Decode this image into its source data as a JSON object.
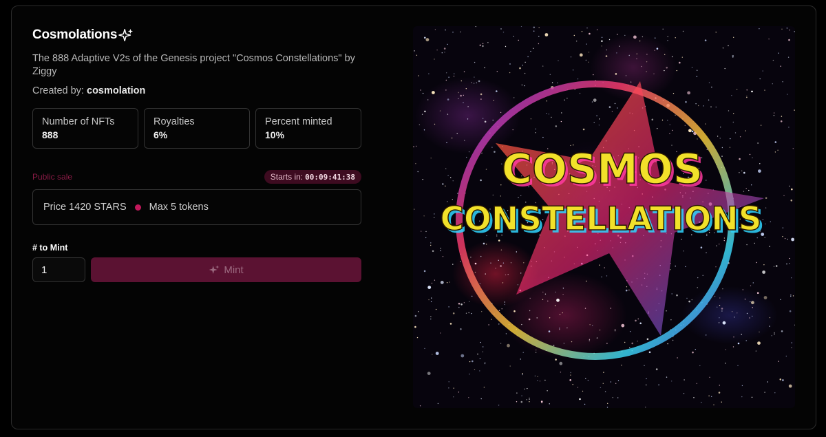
{
  "collection": {
    "title": "Cosmolations",
    "description": "The 888 Adaptive V2s of the Genesis project \"Cosmos Constellations\" by Ziggy",
    "creator_label": "Created by:",
    "creator_name": "cosmolation"
  },
  "stats": [
    {
      "label": "Number of NFTs",
      "value": "888"
    },
    {
      "label": "Royalties",
      "value": "6%"
    },
    {
      "label": "Percent minted",
      "value": "10%"
    }
  ],
  "sale": {
    "label": "Public sale",
    "starts_in_label": "Starts in:",
    "countdown": "00:09:41:38",
    "price_text": "Price 1420 STARS",
    "max_text": "Max 5 tokens"
  },
  "mint": {
    "quantity_label": "# to Mint",
    "quantity_value": "1",
    "button_label": "Mint"
  },
  "artwork": {
    "line1": "COSMOS",
    "line2": "CONSTELLATIONS"
  },
  "colors": {
    "accent": "#c2185b",
    "button_bg": "#5b1232",
    "badge_bg": "#3d0b20",
    "text_fill": "#f2e12a"
  },
  "icons": {
    "title_icon": "sparkles-icon",
    "mint_icon": "sparkles-icon"
  }
}
